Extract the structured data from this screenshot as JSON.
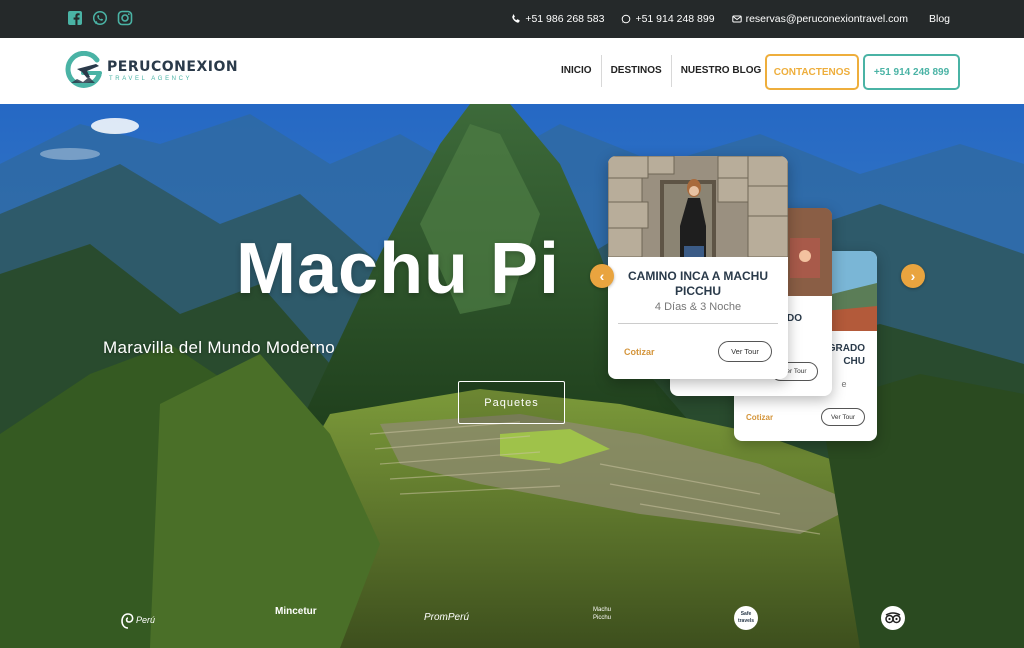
{
  "topbar": {
    "social": [
      "facebook-icon",
      "whatsapp-icon",
      "instagram-icon"
    ],
    "phone1": "+51 986 268 583",
    "phone2": "+51 914 248 899",
    "email": "reservas@peruconexiontravel.com",
    "blog": "Blog"
  },
  "logo": {
    "name_part1": "PERU",
    "name_part2": "CONEXION",
    "tagline": "TRAVEL AGENCY"
  },
  "nav": {
    "items": [
      "INICIO",
      "DESTINOS",
      "NUESTRO BLOG"
    ],
    "contact_button": "CONTACTENOS",
    "phone_button": "+51 914 248 899"
  },
  "hero": {
    "title": "Machu Pi",
    "subtitle": "Maravilla del Mundo Moderno",
    "button": "Paquetes"
  },
  "cards": [
    {
      "title_line1": "CAMINO INCA A MACHU",
      "title_line2": "PICCHU",
      "duration": "4 Días & 3 Noche",
      "cotizar": "Cotizar",
      "ver": "Ver Tour"
    },
    {
      "title_line1": "DO",
      "cotizar": "",
      "ver": "Ver Tour"
    },
    {
      "title_line1": "GRADO",
      "title_line2": "CHU",
      "duration": "e",
      "cotizar": "Cotizar",
      "ver": "Ver Tour"
    }
  ],
  "carousel": {
    "prev": "‹",
    "next": "›"
  },
  "partners": [
    "Perú",
    "Mincetur",
    "PromPerú",
    "Machu Picchu",
    "Safe travels",
    "Tripadvisor"
  ],
  "colors": {
    "topbar_bg": "#25292a",
    "orange": "#eeae3c",
    "teal": "#4ab3a5",
    "dark": "#2a3a4a"
  }
}
